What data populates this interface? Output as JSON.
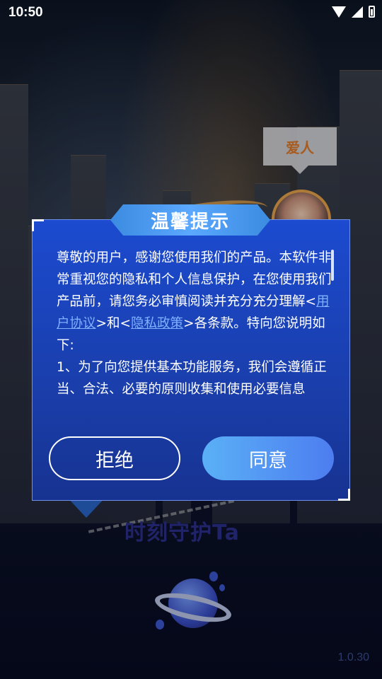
{
  "status_bar": {
    "time": "10:50"
  },
  "background": {
    "bubble_label": "爱人",
    "slogan": "时刻守护Ta",
    "version": "1.0.30"
  },
  "dialog": {
    "title": "温馨提示",
    "text_before_links": "尊敬的用户，感谢您使用我们的产品。本软件非常重视您的隐私和个人信息保护，在您使用我们产品前，请您务必审慎阅读并充分充分理解",
    "link_user_agreement": "用户协议",
    "link_privacy_policy": "隐私政策",
    "text_after_links": "各条款。特向您说明如下:",
    "text_item1": "1、为了向您提供基本功能服务，我们会遵循正当、合法、必要的原则收集和使用必要信息",
    "reject_label": "拒绝",
    "agree_label": "同意"
  }
}
